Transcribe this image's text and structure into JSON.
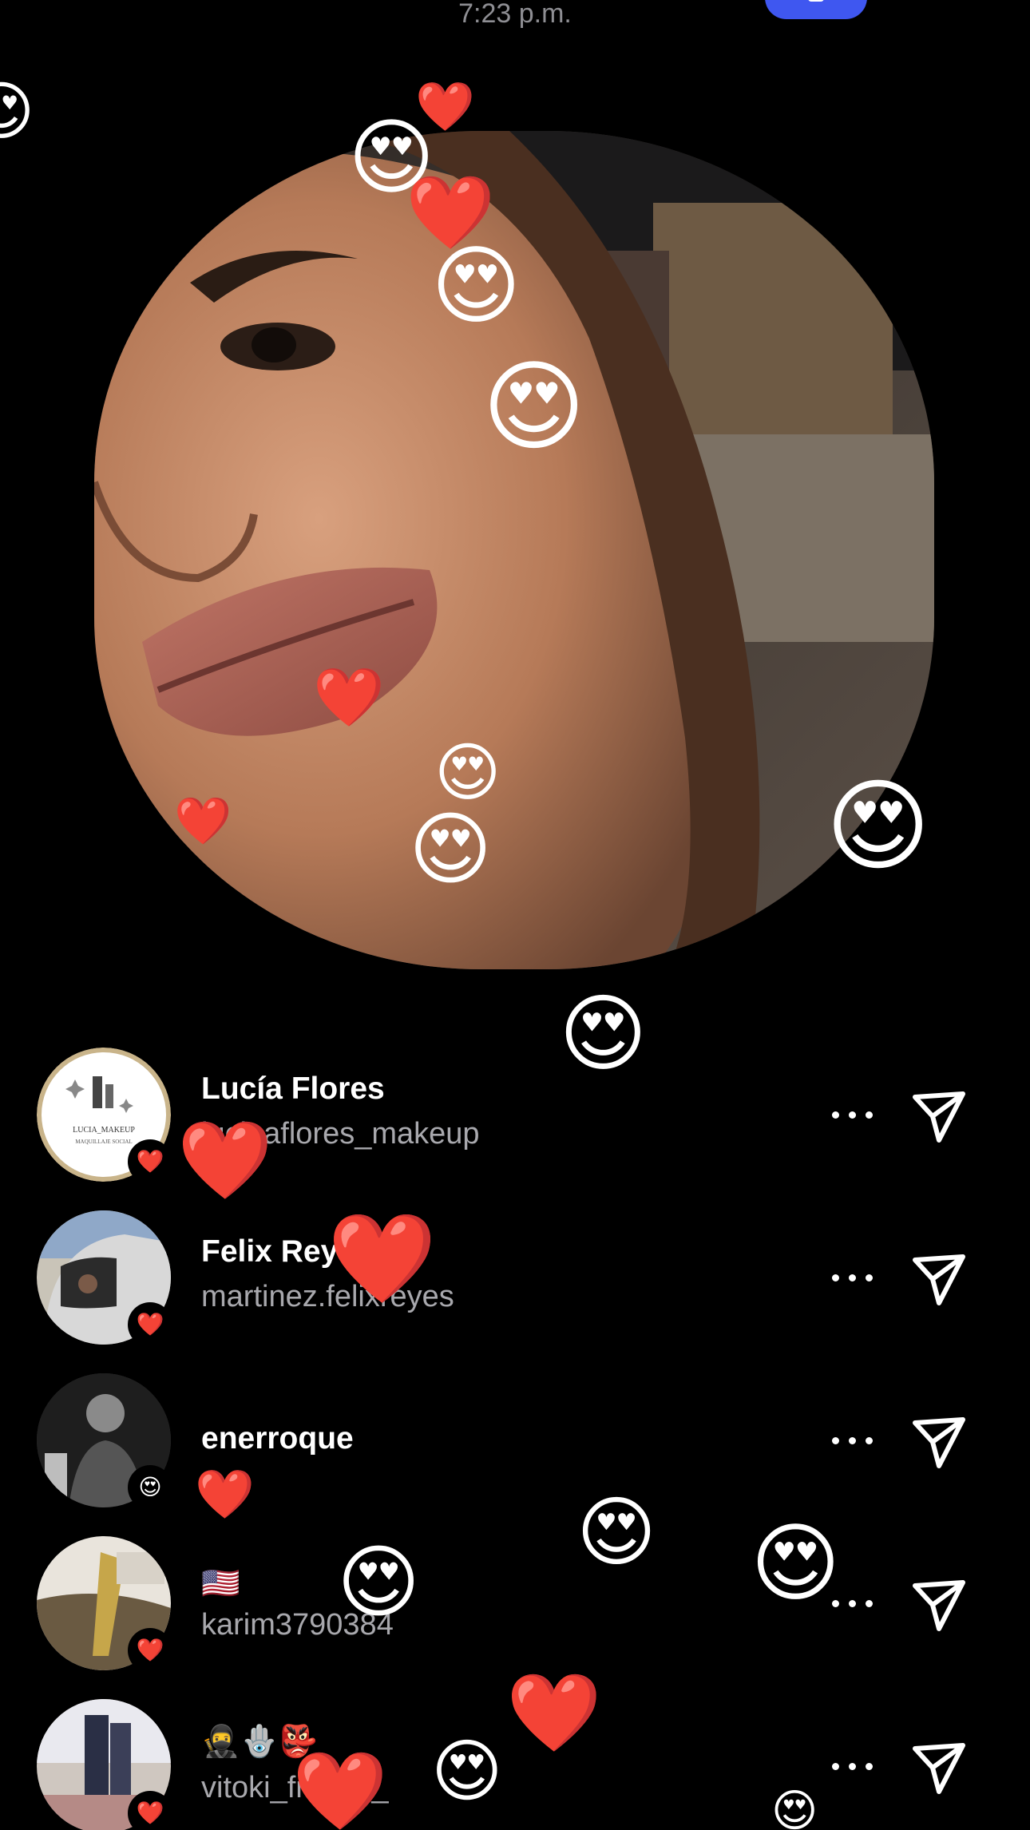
{
  "status_bar": {
    "time": "7:23 p.m."
  },
  "icons": {
    "close": "close-icon",
    "more": "more-dots-icon",
    "send": "send-icon",
    "reaction_heart": "❤️",
    "reaction_heart_eyes": "😍"
  },
  "colors": {
    "background": "#000000",
    "accent_button": "#3f57f0",
    "secondary_text": "#a8a8ad"
  },
  "viewers": [
    {
      "name": "Lucía Flores",
      "handle": "luciaaflores_makeup",
      "reaction": "❤️"
    },
    {
      "name": "Felix Reyes",
      "handle": "martinez.felixreyes",
      "reaction": "❤️"
    },
    {
      "name": "enerroque",
      "handle": "",
      "reaction": "😍"
    },
    {
      "name": "🇺🇸",
      "handle": "karim3790384",
      "reaction": "❤️"
    },
    {
      "name": "🥷🪬👺",
      "handle": "vitoki_franco_",
      "reaction": "❤️"
    }
  ],
  "avatar_logo": {
    "title": "LUCIA_MAKEUP",
    "subtitle": "MAQUILLAJE SOCIAL"
  }
}
